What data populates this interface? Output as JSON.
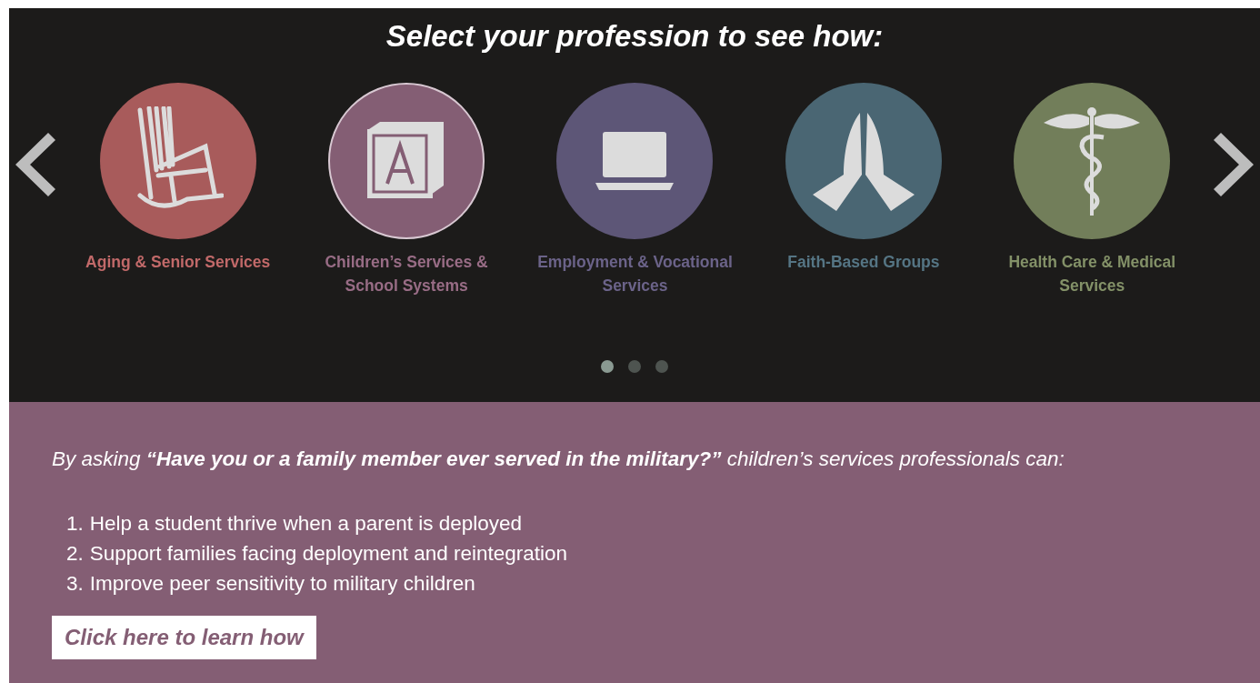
{
  "carousel": {
    "title": "Select your profession to see how:",
    "professions": [
      {
        "kind": "chair",
        "label": "Aging & Senior Services",
        "color": "#a85b5b",
        "selected": false
      },
      {
        "kind": "block",
        "label": "Children’s Services & School Systems",
        "color": "#845e74",
        "selected": true
      },
      {
        "kind": "laptop",
        "label": "Employment & Vocational Services",
        "color": "#5d5677",
        "selected": false
      },
      {
        "kind": "hands",
        "label": "Faith-Based Groups",
        "color": "#4a6673",
        "selected": false
      },
      {
        "kind": "caduceus",
        "label": "Health Care & Medical Services",
        "color": "#727e5a",
        "selected": false
      }
    ],
    "pages": [
      {
        "selected": true
      },
      {
        "selected": false
      },
      {
        "selected": false
      }
    ]
  },
  "detail": {
    "intro": "By asking **“Have you or a family member ever served in the military?”** children’s services professionals can:",
    "items": [
      {
        "number": "1.",
        "text": "Help a student thrive when a parent is deployed"
      },
      {
        "number": "2.",
        "text": "Support families facing deployment and reintegration"
      },
      {
        "number": "3.",
        "text": "Improve peer sensitivity to military children"
      }
    ],
    "button": "Click here to learn how"
  }
}
